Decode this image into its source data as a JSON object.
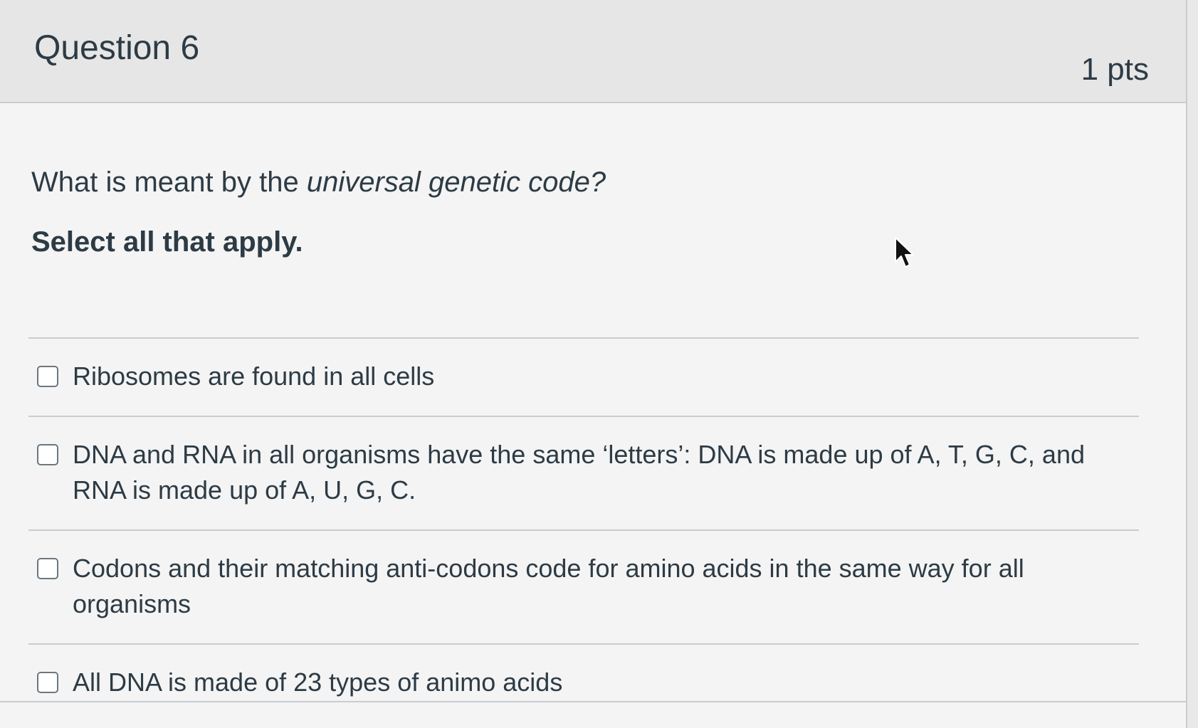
{
  "question": {
    "title": "Question 6",
    "points": "1 pts",
    "prompt_before": "What is meant by the ",
    "prompt_emphasis": "universal genetic code?",
    "instruction": "Select all that apply.",
    "answers": [
      {
        "label": "Ribosomes are found in all cells",
        "checked": false
      },
      {
        "label": "DNA and RNA in all organisms have the same ‘letters’: DNA is made up of A, T, G, C, and RNA is made up of A, U, G, C.",
        "checked": false
      },
      {
        "label": "Codons and their matching anti-codons code for amino acids in the same way for all organisms",
        "checked": false
      },
      {
        "label": "All DNA is made of 23 types of animo acids",
        "checked": false
      }
    ]
  },
  "icons": {
    "cursor": "mouse-pointer-icon",
    "checkbox": "checkbox-unchecked"
  },
  "colors": {
    "text": "#2d3b45",
    "header_background": "#e6e6e6",
    "card_background": "#f4f4f4",
    "border": "#c7cdd1",
    "checkbox_border": "#6b7780"
  }
}
